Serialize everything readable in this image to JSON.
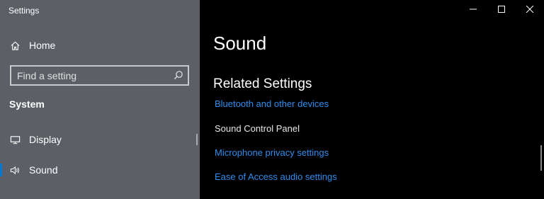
{
  "app": {
    "title": "Settings"
  },
  "sidebar": {
    "home_label": "Home",
    "search": {
      "placeholder": "Find a setting",
      "value": ""
    },
    "section_header": "System",
    "items": [
      {
        "label": "Display",
        "icon": "monitor-icon",
        "active": false
      },
      {
        "label": "Sound",
        "icon": "speaker-icon",
        "active": true
      }
    ]
  },
  "main": {
    "title": "Sound",
    "related_heading": "Related Settings",
    "links": [
      {
        "label": "Bluetooth and other devices"
      },
      {
        "label": "Sound Control Panel"
      },
      {
        "label": "Microphone privacy settings"
      },
      {
        "label": "Ease of Access audio settings"
      }
    ]
  },
  "window_controls": [
    "minimize-icon",
    "maximize-icon",
    "close-icon"
  ],
  "colors": {
    "sidebar_bg": "#5c5f65",
    "main_bg": "#000000",
    "accent": "#0078d7",
    "link": "#2d8ded"
  }
}
